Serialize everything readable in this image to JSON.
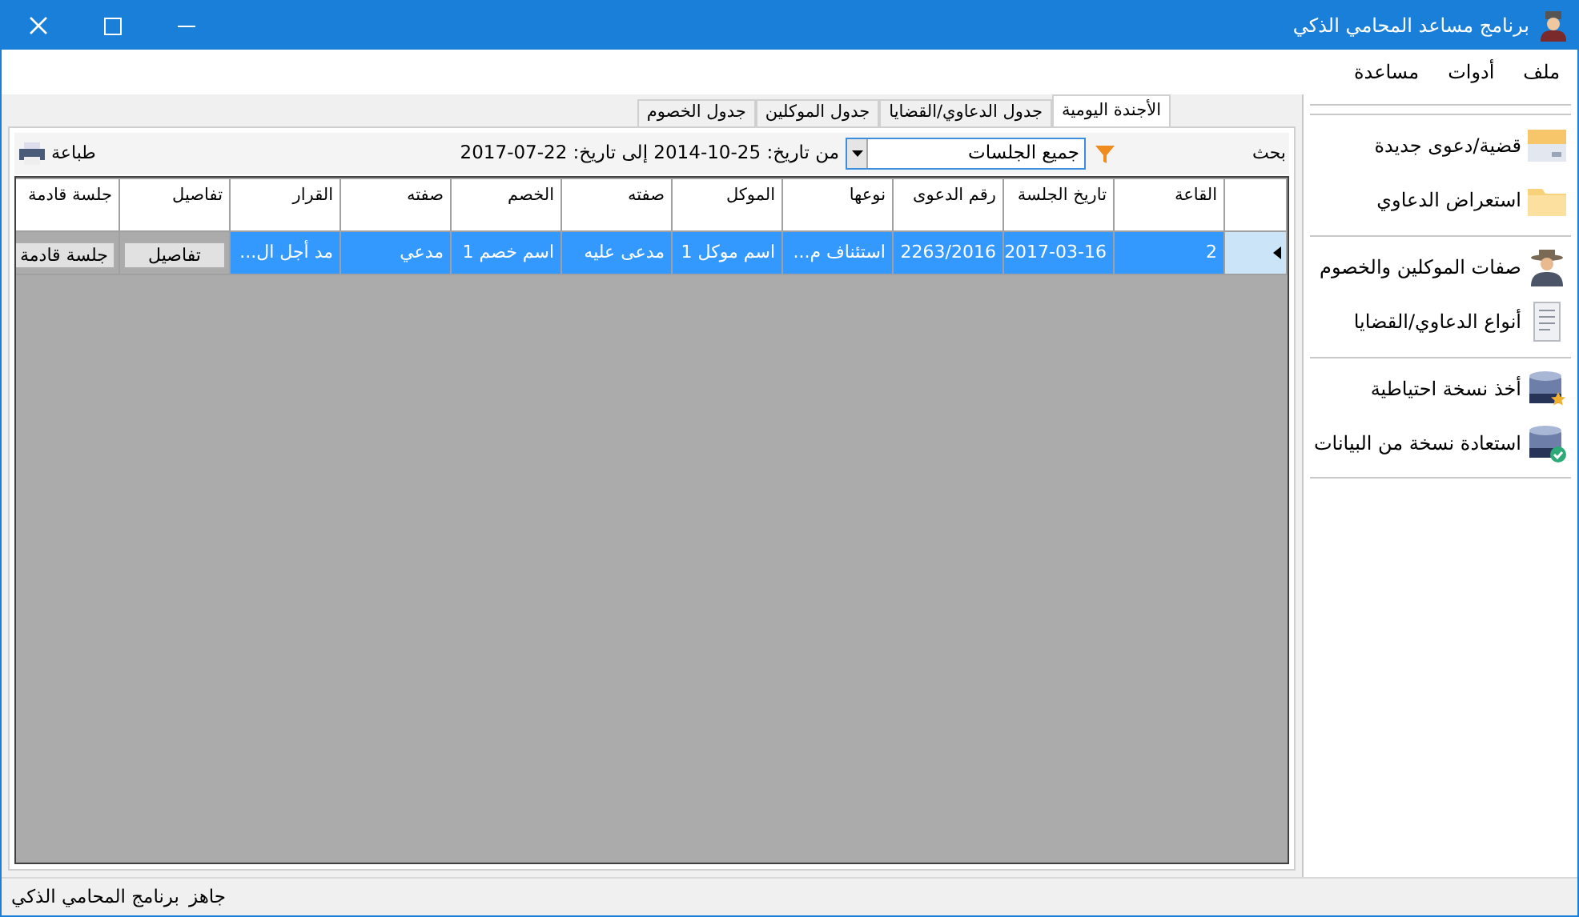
{
  "window": {
    "title": "برنامج مساعد المحامي الذكي"
  },
  "menu": [
    "ملف",
    "أدوات",
    "مساعدة"
  ],
  "tabs": [
    {
      "label": "الأجندة اليومية",
      "selected": true
    },
    {
      "label": "جدول الدعاوي/القضايا",
      "selected": false
    },
    {
      "label": "جدول الموكلين",
      "selected": false
    },
    {
      "label": "جدول الخصوم",
      "selected": false
    }
  ],
  "toolbar": {
    "search": "بحث",
    "filter": {
      "value": "جميع الجلسات"
    },
    "range": "من تاريخ: 25-10-2014 إلى تاريخ: 22-07-2017",
    "print": "طباعة"
  },
  "table": {
    "columns": [
      "القاعة",
      "تاريخ الجلسة",
      "رقم الدعوى",
      "نوعها",
      "الموكل",
      "صفته",
      "الخصم",
      "صفته",
      "القرار",
      "تفاصيل",
      "جلسة قادمة"
    ],
    "rows": [
      {
        "selected": true,
        "cells": [
          {
            "kind": "text",
            "text": "2"
          },
          {
            "kind": "text",
            "text": "2017-03-16"
          },
          {
            "kind": "text",
            "text": "2263/2016"
          },
          {
            "kind": "text",
            "text": "استئناف م..."
          },
          {
            "kind": "text",
            "text": "اسم موكل 1"
          },
          {
            "kind": "text",
            "text": "مدعى عليه"
          },
          {
            "kind": "text",
            "text": "اسم خصم 1"
          },
          {
            "kind": "text",
            "text": "مدعي"
          },
          {
            "kind": "text",
            "text": "مد أجل ال..."
          },
          {
            "kind": "button",
            "text": "تفاصيل"
          },
          {
            "kind": "button",
            "text": "جلسة قادمة"
          }
        ]
      }
    ]
  },
  "sidebar": {
    "groups": [
      [
        {
          "label": "قضية/دعوى جديدة"
        },
        {
          "label": "استعراض الدعاوي"
        }
      ],
      [
        {
          "label": "صفات الموكلين والخصوم"
        },
        {
          "label": "أنواع الدعاوي/القضايا"
        }
      ],
      [
        {
          "label": "أخذ نسخة احتياطية"
        },
        {
          "label": "استعادة نسخة من البيانات"
        }
      ]
    ]
  },
  "status_bar": [
    "جاهز",
    "برنامج المحامي الذكي"
  ]
}
